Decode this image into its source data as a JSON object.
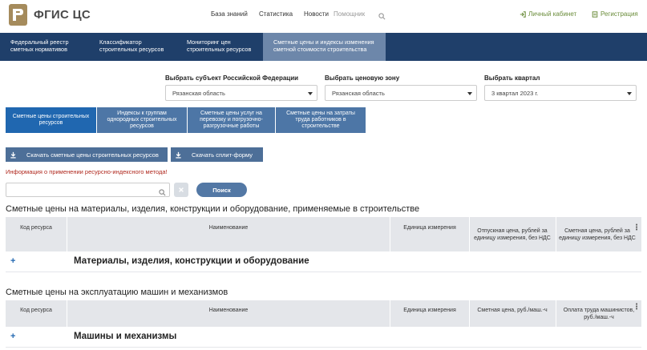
{
  "header": {
    "logo_text": "ФГИС ЦС",
    "nav": [
      "База знаний",
      "Статистика",
      "Новости"
    ],
    "help": "Помощник",
    "cabinet": "Личный кабинет",
    "register": "Регистрация"
  },
  "bluenav": [
    {
      "label": "Федеральный реестр сметных нормативов",
      "active": false
    },
    {
      "label": "Классификатор строительных ресурсов",
      "active": false
    },
    {
      "label": "Мониторинг цен строительных ресурсов",
      "active": false
    },
    {
      "label": "Сметные цены и индексы изменения сметной стоимости строительства",
      "active": true
    }
  ],
  "selects": {
    "subject": {
      "label": "Выбрать субъект Российской Федерации",
      "value": "Рязанская область"
    },
    "zone": {
      "label": "Выбрать ценовую зону",
      "value": "Рязанская область"
    },
    "quarter": {
      "label": "Выбрать квартал",
      "value": "3 квартал 2023 г."
    }
  },
  "tabs": [
    {
      "label": "Сметные цены строительных ресурсов",
      "active": true
    },
    {
      "label": "Индексы к группам однородных строительных ресурсов",
      "active": false
    },
    {
      "label": "Сметные цены услуг на перевозку и погрузочно-разгрузочные работы",
      "active": false
    },
    {
      "label": "Сметные цены на затраты труда работников в строительстве",
      "active": false
    }
  ],
  "downloads": {
    "prices": "Скачать сметные цены строительных ресурсов",
    "split": "Скачать сплит-форму"
  },
  "info_link": "Информация о применении ресурсно-индексного метода!",
  "search": {
    "placeholder": "",
    "button": "Поиск"
  },
  "materials": {
    "title": "Сметные цены на материалы, изделия, конструкции и оборудование, применяемые в строительстве",
    "columns": [
      "Код ресурса",
      "Наименование",
      "Единица измерения",
      "Отпускная цена, рублей за единицу измерения, без НДС",
      "Сметная цена, рублей за единицу измерения, без НДС"
    ],
    "group": "Материалы, изделия, конструкции и оборудование"
  },
  "machines": {
    "title": "Сметные цены на эксплуатацию машин и механизмов",
    "columns": [
      "Код ресурса",
      "Наименование",
      "Единица измерения",
      "Сметная цена, руб./маш.-ч",
      "Оплата труда машинистов, руб./маш.-ч"
    ],
    "group": "Машины и механизмы"
  },
  "colors": {
    "navy": "#1f3f6a",
    "tab_active": "#2067b0",
    "tab": "#4d76a6",
    "brand": "#a58b5c",
    "green": "#6a8c3a",
    "alert": "#b0281e"
  }
}
